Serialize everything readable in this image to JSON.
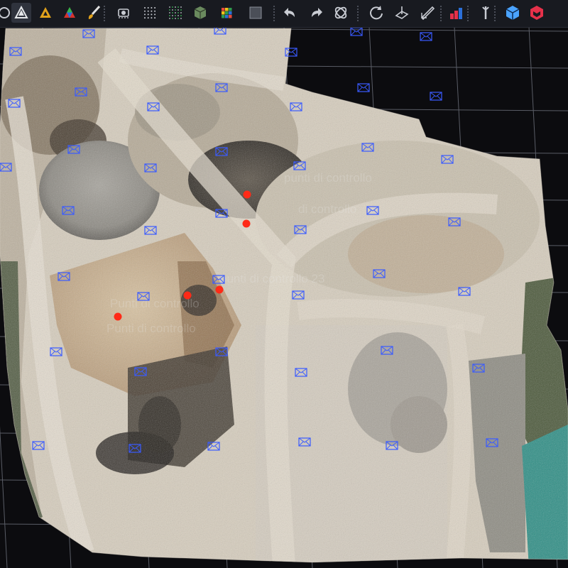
{
  "toolbar": {
    "buttons": [
      {
        "id": "navigate",
        "icon": "navigate-icon",
        "active": false
      },
      {
        "id": "mesh-view",
        "icon": "mesh-triangle-icon",
        "active": true
      },
      {
        "id": "textured-view",
        "icon": "textured-triangle-icon",
        "active": false
      },
      {
        "id": "colored-view",
        "icon": "rgb-triangle-icon",
        "active": false
      },
      {
        "id": "brush",
        "icon": "brush-icon",
        "active": false
      },
      {
        "id": "cameras",
        "icon": "camera-cluster-icon",
        "active": false
      },
      {
        "id": "points",
        "icon": "point-cloud-icon",
        "active": false
      },
      {
        "id": "dense-points",
        "icon": "dense-cloud-icon",
        "active": false
      },
      {
        "id": "model",
        "icon": "cube-model-icon",
        "active": false
      },
      {
        "id": "tiled-model",
        "icon": "rubik-cube-icon",
        "active": false
      },
      {
        "id": "region",
        "icon": "region-box-icon",
        "active": false
      },
      {
        "id": "undo",
        "icon": "undo-icon",
        "active": false
      },
      {
        "id": "redo",
        "icon": "redo-icon",
        "active": false
      },
      {
        "id": "rotate-free",
        "icon": "rotate-free-icon",
        "active": false
      },
      {
        "id": "rotate",
        "icon": "rotate-icon",
        "active": false
      },
      {
        "id": "plane",
        "icon": "plane-tool-icon",
        "active": false
      },
      {
        "id": "ruler",
        "icon": "ruler-icon",
        "active": false
      },
      {
        "id": "stats",
        "icon": "bar-chart-icon",
        "active": false
      },
      {
        "id": "tools",
        "icon": "wrench-icon",
        "active": false
      },
      {
        "id": "cube-blue",
        "icon": "cube-blue-icon",
        "active": false
      },
      {
        "id": "cube-red",
        "icon": "cube-red-icon",
        "active": false
      }
    ],
    "colors": {
      "bg": "#181a20",
      "icon": "#c9ccd3",
      "accent_blue": "#4aa3ff",
      "accent_red": "#e5314a"
    }
  },
  "viewport": {
    "background": "#0c0c0f",
    "grid_color": "#5a5d66",
    "camera_marker_color": "#3a5bff",
    "gcp_color": "#ff2a17",
    "camera_count": 50,
    "gcp_count": 5,
    "overlay_labels": [
      "punti di controllo",
      "di controllo",
      "Punti di controllo",
      "punti di controllo 23",
      "Punti di controllo"
    ]
  }
}
